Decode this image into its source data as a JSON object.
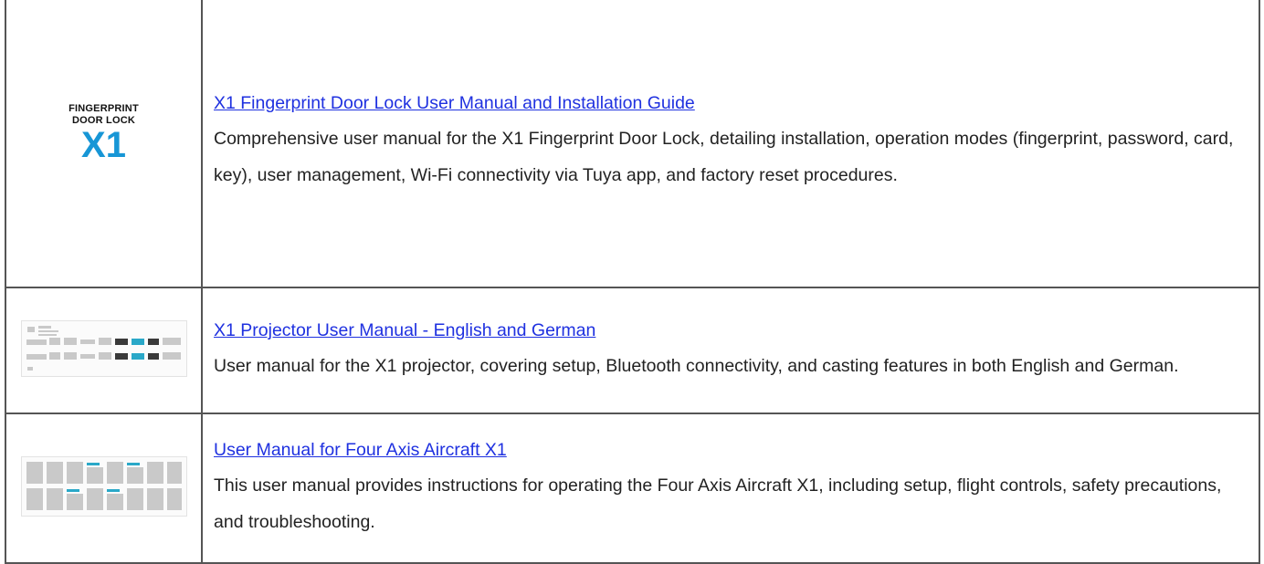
{
  "results": [
    {
      "thumbnail": {
        "icon": "fingerprint-door-lock-logo",
        "line1": "FINGERPRINT",
        "line2": "DOOR LOCK",
        "line3": "X1"
      },
      "title": "X1 Fingerprint Door Lock User Manual and Installation Guide",
      "description": "Comprehensive user manual for the X1 Fingerprint Door Lock, detailing installation, operation modes (fingerprint, password, card, key), user management, Wi-Fi connectivity via Tuya app, and factory reset procedures."
    },
    {
      "thumbnail": {
        "icon": "projector-manual-thumbnail"
      },
      "title": "X1 Projector User Manual - English and German",
      "description": "User manual for the X1 projector, covering setup, Bluetooth connectivity, and casting features in both English and German."
    },
    {
      "thumbnail": {
        "icon": "aircraft-manual-thumbnail"
      },
      "title": "User Manual for Four Axis Aircraft X1",
      "description": "This user manual provides instructions for operating the Four Axis Aircraft X1, including setup, flight controls, safety precautions, and troubleshooting."
    }
  ],
  "colors": {
    "link": "#1f31e0",
    "logo_accent": "#1796d6",
    "border": "#555555"
  }
}
